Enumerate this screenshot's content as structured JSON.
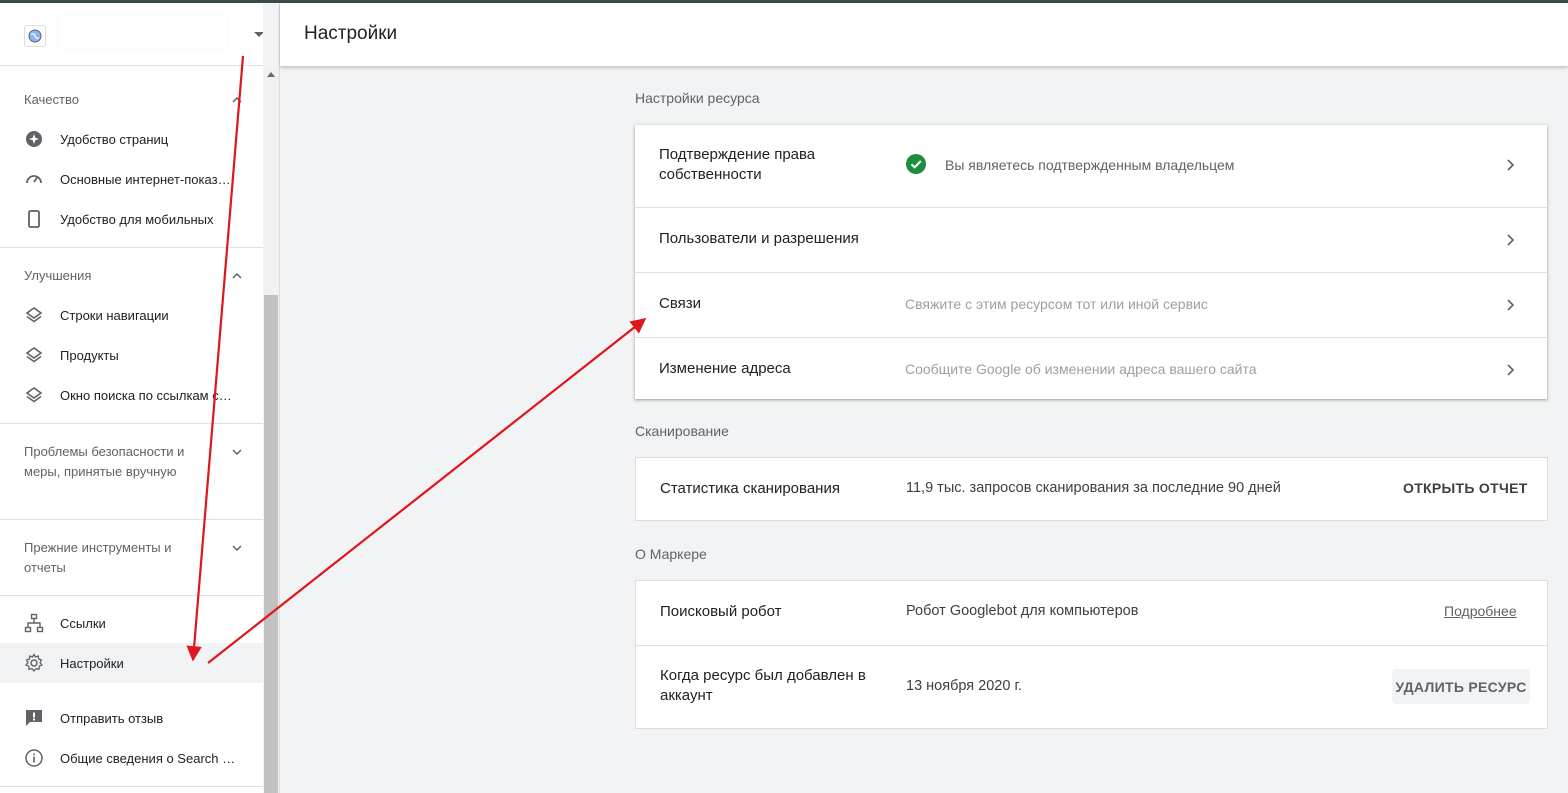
{
  "colors": {
    "accent_green": "#1e8e3e",
    "arrow_red": "#e0161c",
    "text_primary": "#202124",
    "text_secondary": "#5f6368"
  },
  "header": {
    "title": "Настройки"
  },
  "sidebar": {
    "sections": [
      {
        "title": "Качество",
        "expanded": true,
        "items": [
          {
            "label": "Удобство страниц",
            "icon": "plus-circle-icon"
          },
          {
            "label": "Основные интернет-показатели",
            "icon": "speedometer-icon"
          },
          {
            "label": "Удобство для мобильных",
            "icon": "mobile-phone-icon"
          }
        ]
      },
      {
        "title": "Улучшения",
        "expanded": true,
        "items": [
          {
            "label": "Строки навигации",
            "icon": "layers-icon"
          },
          {
            "label": "Продукты",
            "icon": "layers-icon"
          },
          {
            "label": "Окно поиска по ссылкам сайта",
            "icon": "layers-icon"
          }
        ]
      },
      {
        "title": "Проблемы безопасности и меры, принятые вручную",
        "expanded": false,
        "items": []
      },
      {
        "title": "Прежние инструменты и отчеты",
        "expanded": false,
        "items": []
      }
    ],
    "bottom_items": [
      {
        "label": "Ссылки",
        "icon": "sitemap-icon"
      },
      {
        "label": "Настройки",
        "icon": "gear-icon",
        "active": true
      },
      {
        "label": "Отправить отзыв",
        "icon": "feedback-icon"
      },
      {
        "label": "Общие сведения о Search Console",
        "icon": "info-icon"
      }
    ]
  },
  "main": {
    "resource_settings": {
      "title": "Настройки ресурса",
      "rows": [
        {
          "label": "Подтверждение права собственности",
          "status": "Вы являетесь подтвержденным владельцем"
        },
        {
          "label": "Пользователи и разрешения",
          "desc": ""
        },
        {
          "label": "Связи",
          "desc": "Свяжите с этим ресурсом тот или иной сервис"
        },
        {
          "label": "Изменение адреса",
          "desc": "Сообщите Google об изменении адреса вашего сайта"
        }
      ]
    },
    "crawling": {
      "title": "Сканирование",
      "row": {
        "label": "Статистика сканирования",
        "value": "11,9 тыс. запросов сканирования за последние 90 дней",
        "action": "ОТКРЫТЬ ОТЧЕТ"
      }
    },
    "about": {
      "title": "О Маркере",
      "rows": [
        {
          "label": "Поисковый робот",
          "value": "Робот Googlebot для компьютеров",
          "action": "Подробнее"
        },
        {
          "label": "Когда ресурс был добавлен в аккаунт",
          "value": "13 ноября 2020 г.",
          "action": "УДАЛИТЬ РЕСУРС"
        }
      ]
    }
  }
}
